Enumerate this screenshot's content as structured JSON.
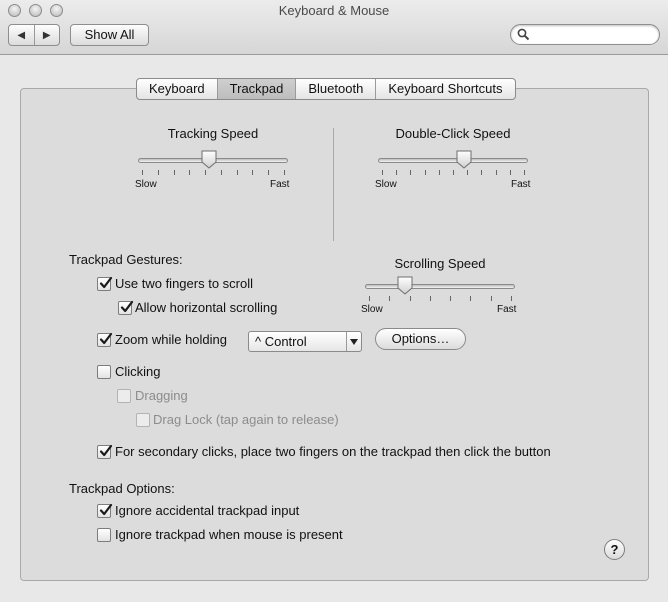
{
  "window": {
    "title": "Keyboard & Mouse"
  },
  "toolbar": {
    "back_glyph": "◀",
    "forward_glyph": "▶",
    "show_all": "Show All",
    "search_placeholder": "",
    "search_value": ""
  },
  "tabs": [
    {
      "label": "Keyboard",
      "selected": false
    },
    {
      "label": "Trackpad",
      "selected": true
    },
    {
      "label": "Bluetooth",
      "selected": false
    },
    {
      "label": "Keyboard Shortcuts",
      "selected": false
    }
  ],
  "tracking_speed": {
    "label": "Tracking Speed",
    "min_label": "Slow",
    "max_label": "Fast",
    "value": 0.47,
    "ticks": 10
  },
  "double_click_speed": {
    "label": "Double-Click Speed",
    "min_label": "Slow",
    "max_label": "Fast",
    "value": 0.58,
    "ticks": 11
  },
  "scrolling_speed": {
    "label": "Scrolling Speed",
    "min_label": "Slow",
    "max_label": "Fast",
    "value": 0.25,
    "ticks": 8
  },
  "gestures": {
    "heading": "Trackpad Gestures:",
    "two_fingers_scroll": {
      "label": "Use two fingers to scroll",
      "checked": true
    },
    "horizontal_scroll": {
      "label": "Allow horizontal scrolling",
      "checked": true
    },
    "zoom": {
      "label": "Zoom while holding",
      "checked": true,
      "modifier": "^ Control",
      "options_button": "Options…"
    },
    "clicking": {
      "label": "Clicking",
      "checked": false
    },
    "dragging": {
      "label": "Dragging",
      "checked": false,
      "enabled": false
    },
    "drag_lock": {
      "label": "Drag Lock (tap again to release)",
      "checked": false,
      "enabled": false
    },
    "secondary_click": {
      "label": "For secondary clicks, place two fingers on the trackpad then click the button",
      "checked": true
    }
  },
  "options": {
    "heading": "Trackpad Options:",
    "ignore_accidental": {
      "label": "Ignore accidental trackpad input",
      "checked": true
    },
    "ignore_when_mouse": {
      "label": "Ignore trackpad when mouse is present",
      "checked": false
    }
  },
  "help": {
    "label": "?"
  },
  "colors": {
    "window_bg": "#e8e8e8",
    "panel_bg": "#dcdcdc",
    "selected_tab": "#c4c4c4"
  }
}
